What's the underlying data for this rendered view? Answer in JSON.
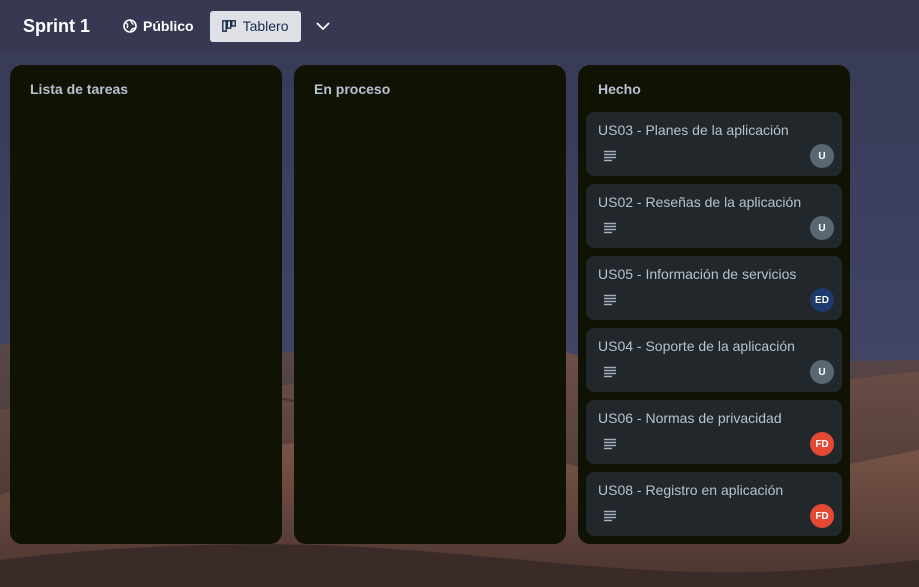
{
  "board": {
    "title": "Sprint 1",
    "visibility_label": "Público",
    "view_label": "Tablero"
  },
  "lists": [
    {
      "title": "Lista de tareas"
    },
    {
      "title": "En proceso"
    },
    {
      "title": "Hecho"
    }
  ],
  "cards": [
    {
      "title": "US03 - Planes de la aplicación",
      "member": "U",
      "color": "#596773"
    },
    {
      "title": "US02 - Reseñas de la aplicación",
      "member": "U",
      "color": "#596773"
    },
    {
      "title": "US05 - Información de servicios",
      "member": "ED",
      "color": "#1d3a6b"
    },
    {
      "title": "US04 - Soporte de la aplicación",
      "member": "U",
      "color": "#596773"
    },
    {
      "title": "US06 - Normas de privacidad",
      "member": "FD",
      "color": "#e34935"
    },
    {
      "title": "US08 - Registro en aplicación",
      "member": "FD",
      "color": "#e34935"
    }
  ],
  "icons": {
    "visibility": "globe-icon",
    "view": "board-icon",
    "menu": "chevron-down-icon",
    "description": "description-icon"
  }
}
